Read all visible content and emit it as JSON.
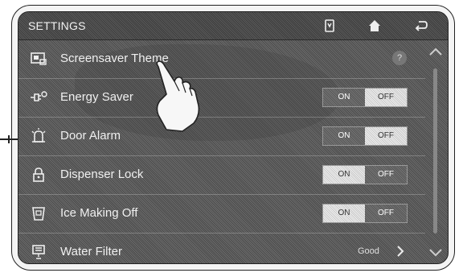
{
  "header": {
    "title": "SETTINGS",
    "icons": [
      "timer-icon",
      "home-icon",
      "back-icon"
    ]
  },
  "rows": [
    {
      "label": "Screensaver Theme",
      "icon": "screen-icon",
      "control": "info"
    },
    {
      "label": "Energy Saver",
      "icon": "plug-icon",
      "control": "toggle",
      "on": "ON",
      "off": "OFF",
      "state": "OFF"
    },
    {
      "label": "Door Alarm",
      "icon": "alarm-icon",
      "control": "toggle",
      "on": "ON",
      "off": "OFF",
      "state": "OFF"
    },
    {
      "label": "Dispenser Lock",
      "icon": "lock-icon",
      "control": "toggle",
      "on": "ON",
      "off": "OFF",
      "state": "ON"
    },
    {
      "label": "Ice Making Off",
      "icon": "ice-bucket-icon",
      "control": "toggle",
      "on": "ON",
      "off": "OFF",
      "state": "ON"
    },
    {
      "label": "Water Filter",
      "icon": "water-filter-icon",
      "control": "status",
      "value": "Good"
    }
  ],
  "info_glyph": "?",
  "colors": {
    "screen": "#4a4a4a",
    "text": "#f0f0f0"
  }
}
